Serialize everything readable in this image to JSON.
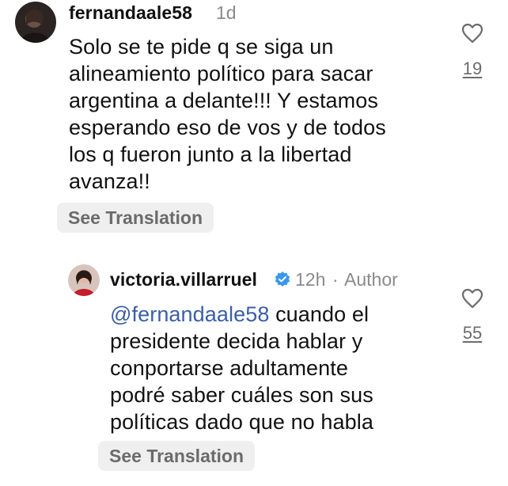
{
  "comments": [
    {
      "username": "fernandaale58",
      "time": "1d",
      "lines": [
        "Solo se te pide q se siga un",
        "alineamiento político para sacar",
        "argentina a delante!!! Y estamos",
        "esperando eso de vos y de todos",
        "los q fueron junto a la libertad",
        "avanza!!"
      ],
      "see_translation": "See Translation",
      "likes": "19",
      "avatar_icon": "user-avatar-dark",
      "like_icon": "heart-outline-icon"
    },
    {
      "username": "victoria.villarruel",
      "time": "12h",
      "separator": "·",
      "role": "Author",
      "verified_icon": "verified-badge-icon",
      "mention": "@fernandaale58",
      "first_line_rest": " cuando el",
      "lines": [
        "presidente decida hablar y",
        "conportarse adultamente",
        "podré saber cuáles son sus",
        "políticas dado que no habla"
      ],
      "see_translation": "See Translation",
      "likes": "55",
      "avatar_icon": "user-avatar-red",
      "like_icon": "heart-outline-icon"
    }
  ],
  "colors": {
    "text": "#111111",
    "meta": "#8a8a8a",
    "mention": "#3a5ea8",
    "verified": "#3897f0",
    "pill_bg": "#efefef"
  }
}
